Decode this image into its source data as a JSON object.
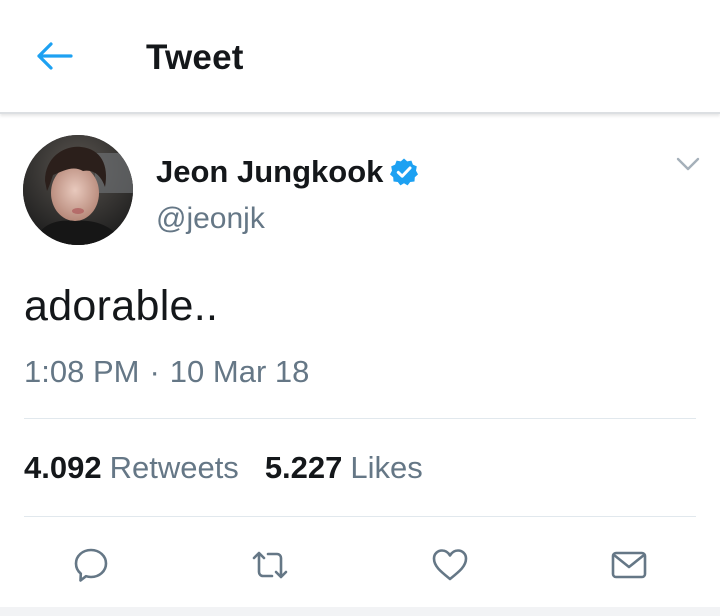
{
  "header": {
    "title": "Tweet",
    "back_icon": "arrow-left-icon"
  },
  "tweet": {
    "author": {
      "name": "Jeon Jungkook",
      "handle": "@jeonjk",
      "verified": true
    },
    "text": "adorable..",
    "time": "1:08 PM",
    "separator": "·",
    "date": "10 Mar 18",
    "stats": {
      "retweets_count": "4.092",
      "retweets_label": "Retweets",
      "likes_count": "5.227",
      "likes_label": "Likes"
    },
    "actions": [
      "reply-icon",
      "retweet-icon",
      "like-icon",
      "share-icon"
    ]
  },
  "colors": {
    "accent": "#1da1f2",
    "text_primary": "#14171a",
    "text_secondary": "#657786",
    "divider": "#e1e8ed",
    "icon": "#657786"
  }
}
